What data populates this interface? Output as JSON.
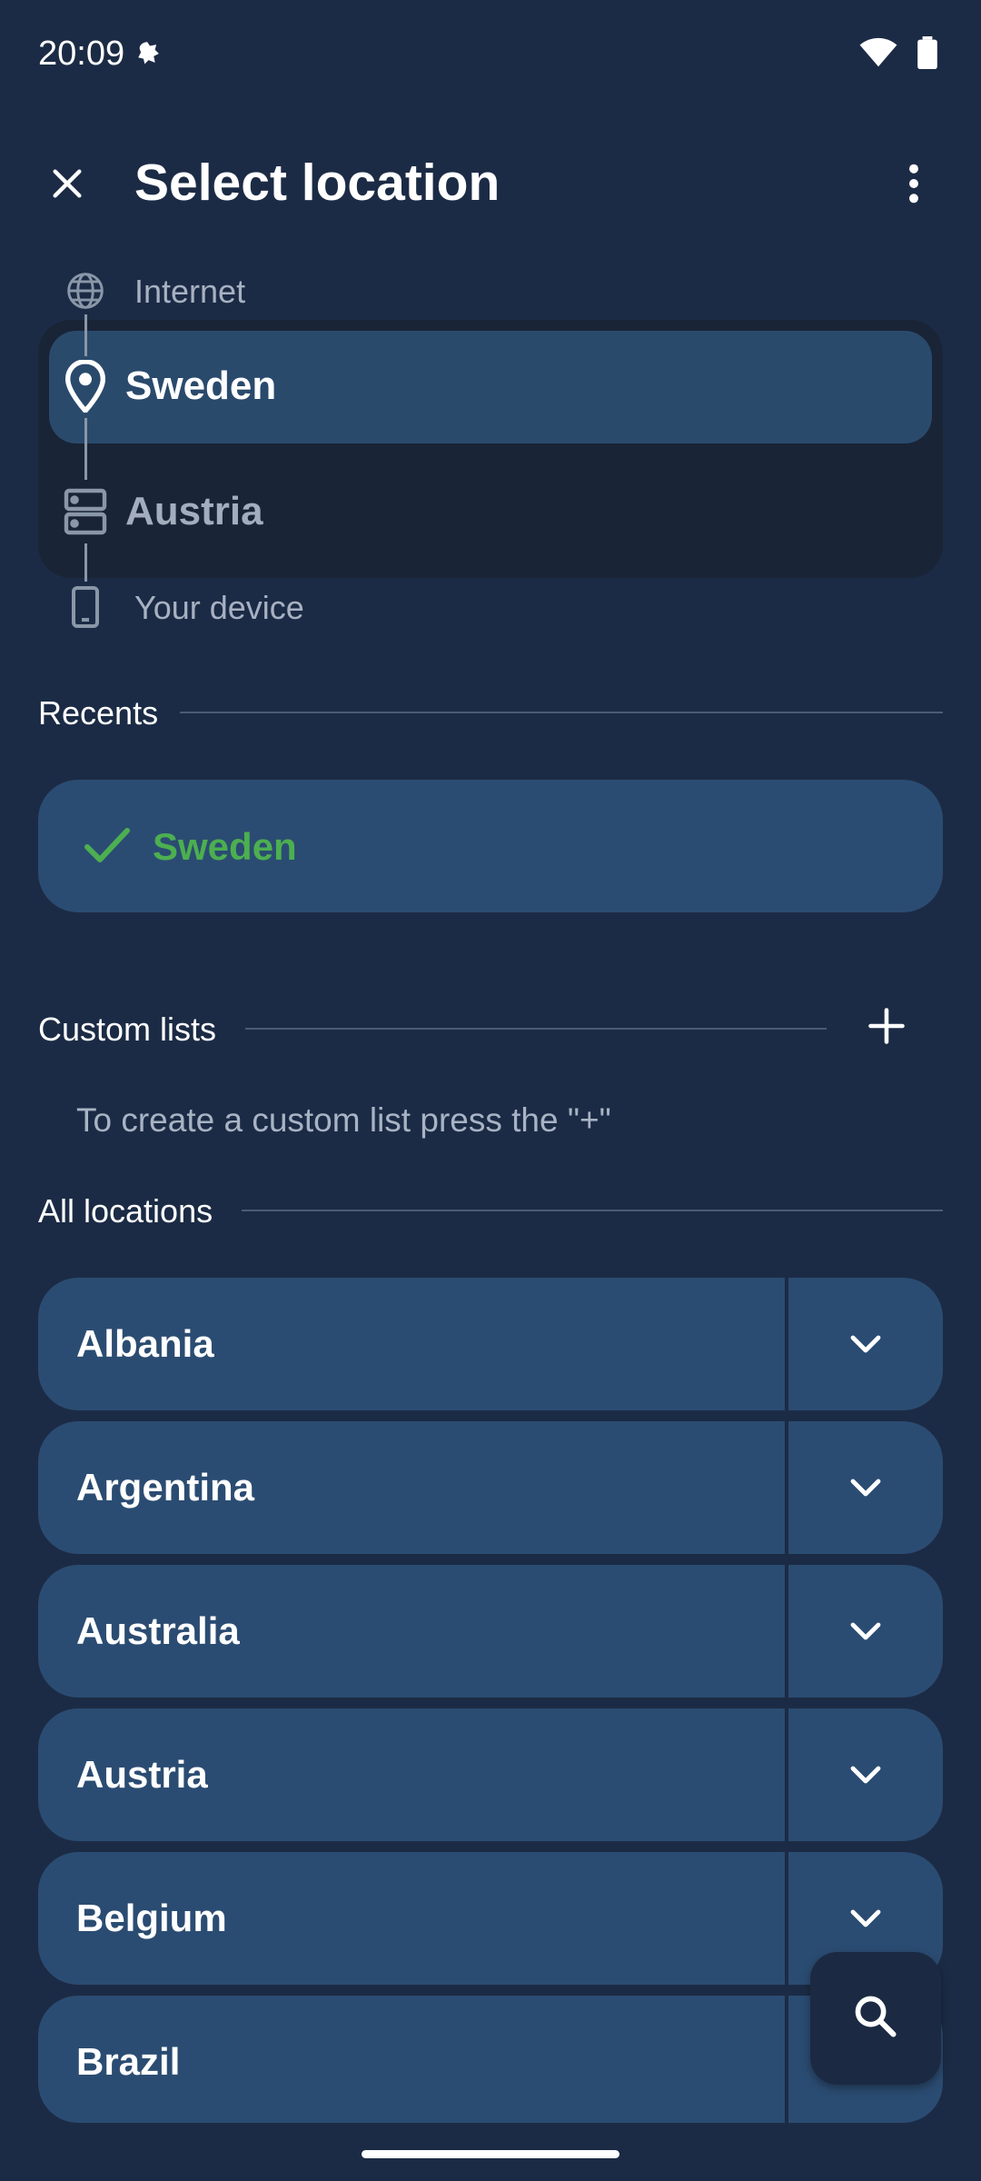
{
  "status_bar": {
    "time": "20:09"
  },
  "header": {
    "title": "Select location"
  },
  "hop_path": {
    "internet": "Internet",
    "entry": "Sweden",
    "exit": "Austria",
    "device": "Your device"
  },
  "recents": {
    "title": "Recents",
    "items": [
      {
        "label": "Sweden",
        "selected": true
      }
    ]
  },
  "custom_lists": {
    "title": "Custom lists",
    "hint": "To create a custom list press the \"+\""
  },
  "all_locations": {
    "title": "All locations",
    "items": [
      {
        "label": "Albania"
      },
      {
        "label": "Argentina"
      },
      {
        "label": "Australia"
      },
      {
        "label": "Austria"
      },
      {
        "label": "Belgium"
      },
      {
        "label": "Brazil"
      }
    ]
  },
  "colors": {
    "background": "#1c2b45",
    "card": "#2b4c72",
    "selected_green": "#4caf50"
  },
  "icons": [
    "close-icon",
    "more-vert-icon",
    "globe-icon",
    "location-pin-icon",
    "server-icon",
    "phone-icon",
    "check-icon",
    "add-icon",
    "chevron-down-icon",
    "search-icon"
  ]
}
